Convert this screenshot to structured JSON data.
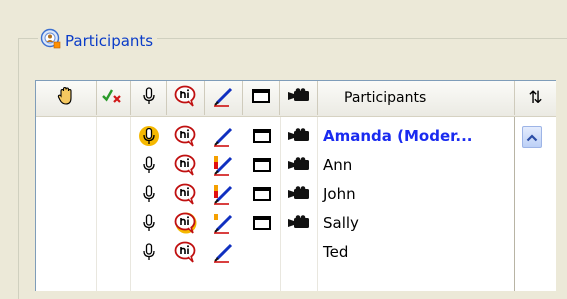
{
  "groupbox": {
    "title": "Participants",
    "icon": "participants-icon"
  },
  "columns": [
    {
      "name": "raise-hand",
      "icon": "hand-icon"
    },
    {
      "name": "approve-deny",
      "icon": "check-x-icon"
    },
    {
      "name": "microphone",
      "icon": "microphone-icon"
    },
    {
      "name": "chat",
      "icon": "chat-bubble-icon"
    },
    {
      "name": "annotate",
      "icon": "pen-icon"
    },
    {
      "name": "screen",
      "icon": "screen-icon"
    },
    {
      "name": "video",
      "icon": "camera-icon"
    },
    {
      "name": "participants",
      "label": "Participants"
    },
    {
      "name": "sort",
      "icon": "sort-arrows-icon"
    }
  ],
  "participants": [
    {
      "name": "Amanda (Moder...",
      "moderator": true,
      "mic_active": true,
      "chat_active": false,
      "pen_level": 0,
      "screen": true,
      "video": true
    },
    {
      "name": "Ann",
      "moderator": false,
      "mic_active": false,
      "chat_active": false,
      "pen_level": 2,
      "screen": true,
      "video": true
    },
    {
      "name": "John",
      "moderator": false,
      "mic_active": false,
      "chat_active": false,
      "pen_level": 2,
      "screen": true,
      "video": true
    },
    {
      "name": "Sally",
      "moderator": false,
      "mic_active": false,
      "chat_active": true,
      "pen_level": 1,
      "screen": true,
      "video": true
    },
    {
      "name": "Ted",
      "moderator": false,
      "mic_active": false,
      "chat_active": false,
      "pen_level": 0,
      "screen": false,
      "video": false
    }
  ],
  "colors": {
    "accent": "#0a3cc8",
    "moderator": "#1a2bf0",
    "highlight": "#f5b800",
    "pen_red": "#e01010",
    "pen_orange": "#f5a000"
  }
}
